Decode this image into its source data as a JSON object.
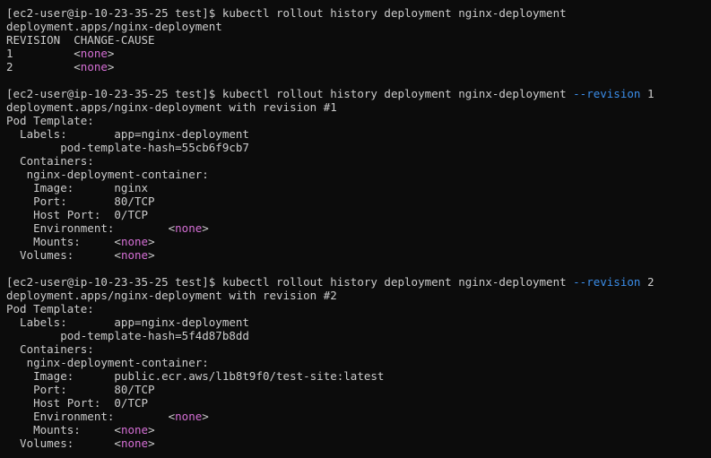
{
  "terminal": {
    "colors": {
      "background": "#0c0c0c",
      "text": "#cccccc",
      "none_value": "#d670d6",
      "flag": "#3b8eea"
    },
    "lines": [
      [
        {
          "t": "[ec2-user@ip-10-23-35-25 test]$ kubectl rollout history deployment nginx-deployment",
          "c": "default"
        }
      ],
      [
        {
          "t": "deployment.apps/nginx-deployment",
          "c": "default"
        }
      ],
      [
        {
          "t": "REVISION  CHANGE-CAUSE",
          "c": "default"
        }
      ],
      [
        {
          "t": "1         ",
          "c": "default"
        },
        {
          "t": "<",
          "c": "default"
        },
        {
          "t": "none",
          "c": "magenta"
        },
        {
          "t": ">",
          "c": "default"
        }
      ],
      [
        {
          "t": "2         ",
          "c": "default"
        },
        {
          "t": "<",
          "c": "default"
        },
        {
          "t": "none",
          "c": "magenta"
        },
        {
          "t": ">",
          "c": "default"
        }
      ],
      [
        {
          "t": "",
          "c": "default"
        }
      ],
      [
        {
          "t": "[ec2-user@ip-10-23-35-25 test]$ kubectl rollout history deployment nginx-deployment ",
          "c": "default"
        },
        {
          "t": "--revision",
          "c": "blue"
        },
        {
          "t": " 1",
          "c": "default"
        }
      ],
      [
        {
          "t": "deployment.apps/nginx-deployment with revision #1",
          "c": "default"
        }
      ],
      [
        {
          "t": "Pod Template:",
          "c": "default"
        }
      ],
      [
        {
          "t": "  Labels:       app=nginx-deployment",
          "c": "default"
        }
      ],
      [
        {
          "t": "        pod-template-hash=55cb6f9cb7",
          "c": "default"
        }
      ],
      [
        {
          "t": "  Containers:",
          "c": "default"
        }
      ],
      [
        {
          "t": "   nginx-deployment-container:",
          "c": "default"
        }
      ],
      [
        {
          "t": "    Image:      nginx",
          "c": "default"
        }
      ],
      [
        {
          "t": "    Port:       80/TCP",
          "c": "default"
        }
      ],
      [
        {
          "t": "    Host Port:  0/TCP",
          "c": "default"
        }
      ],
      [
        {
          "t": "    Environment:        ",
          "c": "default"
        },
        {
          "t": "<",
          "c": "default"
        },
        {
          "t": "none",
          "c": "magenta"
        },
        {
          "t": ">",
          "c": "default"
        }
      ],
      [
        {
          "t": "    Mounts:     ",
          "c": "default"
        },
        {
          "t": "<",
          "c": "default"
        },
        {
          "t": "none",
          "c": "magenta"
        },
        {
          "t": ">",
          "c": "default"
        }
      ],
      [
        {
          "t": "  Volumes:      ",
          "c": "default"
        },
        {
          "t": "<",
          "c": "default"
        },
        {
          "t": "none",
          "c": "magenta"
        },
        {
          "t": ">",
          "c": "default"
        }
      ],
      [
        {
          "t": "",
          "c": "default"
        }
      ],
      [
        {
          "t": "[ec2-user@ip-10-23-35-25 test]$ kubectl rollout history deployment nginx-deployment ",
          "c": "default"
        },
        {
          "t": "--revision",
          "c": "blue"
        },
        {
          "t": " 2",
          "c": "default"
        }
      ],
      [
        {
          "t": "deployment.apps/nginx-deployment with revision #2",
          "c": "default"
        }
      ],
      [
        {
          "t": "Pod Template:",
          "c": "default"
        }
      ],
      [
        {
          "t": "  Labels:       app=nginx-deployment",
          "c": "default"
        }
      ],
      [
        {
          "t": "        pod-template-hash=5f4d87b8dd",
          "c": "default"
        }
      ],
      [
        {
          "t": "  Containers:",
          "c": "default"
        }
      ],
      [
        {
          "t": "   nginx-deployment-container:",
          "c": "default"
        }
      ],
      [
        {
          "t": "    Image:      public.ecr.aws/l1b8t9f0/test-site:latest",
          "c": "default"
        }
      ],
      [
        {
          "t": "    Port:       80/TCP",
          "c": "default"
        }
      ],
      [
        {
          "t": "    Host Port:  0/TCP",
          "c": "default"
        }
      ],
      [
        {
          "t": "    Environment:        ",
          "c": "default"
        },
        {
          "t": "<",
          "c": "default"
        },
        {
          "t": "none",
          "c": "magenta"
        },
        {
          "t": ">",
          "c": "default"
        }
      ],
      [
        {
          "t": "    Mounts:     ",
          "c": "default"
        },
        {
          "t": "<",
          "c": "default"
        },
        {
          "t": "none",
          "c": "magenta"
        },
        {
          "t": ">",
          "c": "default"
        }
      ],
      [
        {
          "t": "  Volumes:      ",
          "c": "default"
        },
        {
          "t": "<",
          "c": "default"
        },
        {
          "t": "none",
          "c": "magenta"
        },
        {
          "t": ">",
          "c": "default"
        }
      ]
    ]
  }
}
